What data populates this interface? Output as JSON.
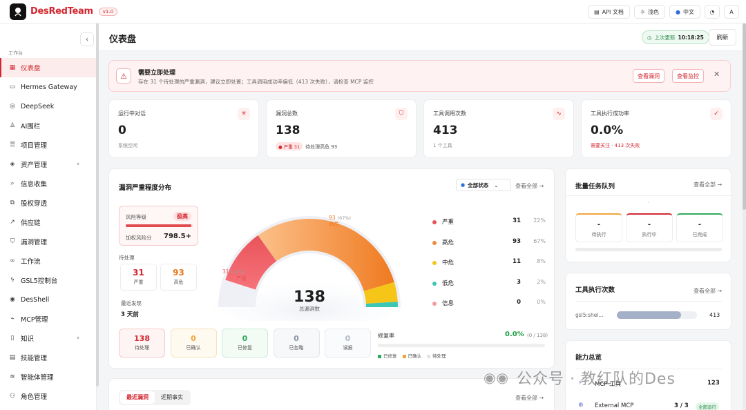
{
  "brand": {
    "name": "DesRedTeam",
    "version": "v1.0"
  },
  "topbar": {
    "api_docs": "API 文档",
    "theme": "浅色",
    "language": "中文"
  },
  "sidebar": {
    "group_label": "工作台",
    "items": [
      {
        "label": "仪表盘",
        "icon": "grid-icon",
        "active": true
      },
      {
        "label": "Hermes Gateway",
        "icon": "chat-icon"
      },
      {
        "label": "DeepSeek",
        "icon": "target-icon"
      },
      {
        "label": "AI围栏",
        "icon": "user-icon"
      },
      {
        "label": "项目管理",
        "icon": "list-icon"
      },
      {
        "label": "资产管理",
        "icon": "layers-icon",
        "expandable": true
      },
      {
        "label": "信息收集",
        "icon": "search-icon"
      },
      {
        "label": "股权穿透",
        "icon": "network-icon"
      },
      {
        "label": "供应链",
        "icon": "trend-icon"
      },
      {
        "label": "漏洞管理",
        "icon": "shield-icon"
      },
      {
        "label": "工作流",
        "icon": "flow-icon"
      },
      {
        "label": "GSL5控制台",
        "icon": "bolt-icon"
      },
      {
        "label": "DesShell",
        "icon": "radio-icon"
      },
      {
        "label": "MCP管理",
        "icon": "plug-icon"
      },
      {
        "label": "知识",
        "icon": "book-icon",
        "expandable": true
      },
      {
        "label": "技能管理",
        "icon": "doc-icon"
      },
      {
        "label": "智能体管理",
        "icon": "stack-icon"
      },
      {
        "label": "角色管理",
        "icon": "users-icon"
      }
    ]
  },
  "header": {
    "title": "仪表盘",
    "last_update_label": "上次更新",
    "last_update_time": "10:18:25",
    "refresh": "刷新"
  },
  "alert": {
    "title": "需要立即处理",
    "text": "存在 31 个待处理的严重漏洞，建议立即处置；工具调用成功率偏低（413 次失败），请检查 MCP 监控",
    "btn_vulns": "查看漏洞",
    "btn_monitor": "查看监控"
  },
  "stats": [
    {
      "label": "运行中对话",
      "value": "0",
      "sub": "系统空闲",
      "icon": "spinner-icon"
    },
    {
      "label": "漏洞总数",
      "value": "138",
      "pill": "● 严重 31",
      "sub": "待处理高危 93",
      "icon": "shield-icon"
    },
    {
      "label": "工具调用次数",
      "value": "413",
      "sub": "1 个工具",
      "icon": "pulse-icon"
    },
    {
      "label": "工具执行成功率",
      "value": "0.0%",
      "sub": "需要关注 · 413 次失败",
      "icon": "check-icon"
    }
  ],
  "severity": {
    "title": "漏洞严重程度分布",
    "filter": "全部状态",
    "view_all": "查看全部 →",
    "risk_label": "风险等级",
    "risk_level": "极高",
    "risk_fill": 0.98,
    "score_label": "加权风险分",
    "score": "798.5+",
    "pending_title": "待处理",
    "pending": [
      {
        "value": "31",
        "label": "严重"
      },
      {
        "value": "93",
        "label": "高危"
      }
    ],
    "recent_title": "最近发现",
    "recent_value": "3 天前",
    "total": "138",
    "total_label": "总漏洞数",
    "arc_labels": [
      {
        "count": "31",
        "pct": "(22%)",
        "name": "严重"
      },
      {
        "count": "93",
        "pct": "(67%)",
        "name": "高危"
      }
    ],
    "legend": [
      {
        "name": "严重",
        "count": "31",
        "pct": "22%",
        "color": "#e9545a"
      },
      {
        "name": "高危",
        "count": "93",
        "pct": "67%",
        "color": "#f28a3a"
      },
      {
        "name": "中危",
        "count": "11",
        "pct": "8%",
        "color": "#f5c518"
      },
      {
        "name": "低危",
        "count": "3",
        "pct": "2%",
        "color": "#3cc7b4"
      },
      {
        "name": "信息",
        "count": "0",
        "pct": "0%",
        "color": "#f19aa0"
      }
    ],
    "status_boxes": [
      {
        "value": "138",
        "label": "待处理"
      },
      {
        "value": "0",
        "label": "已确认"
      },
      {
        "value": "0",
        "label": "已修复"
      },
      {
        "value": "0",
        "label": "已忽略"
      },
      {
        "value": "0",
        "label": "误报"
      }
    ],
    "fix_rate_label": "修复率",
    "fix_rate": "0.0%",
    "fix_rate_den": "(0 / 138)",
    "fix_legend": [
      "已修复",
      "已确认",
      "待处理"
    ]
  },
  "chart_data": {
    "type": "pie",
    "title": "漏洞严重程度分布",
    "categories": [
      "严重",
      "高危",
      "中危",
      "低危",
      "信息"
    ],
    "values": [
      31,
      93,
      11,
      3,
      0
    ]
  },
  "batch_queue": {
    "title": "批量任务队列",
    "view_all": "查看全部 →",
    "dot": "·",
    "boxes": [
      {
        "value": "-",
        "label": "待执行",
        "color": "#f0a43a"
      },
      {
        "value": "-",
        "label": "执行中",
        "color": "#d3272f"
      },
      {
        "value": "-",
        "label": "已完成",
        "color": "#2eaa5c"
      }
    ]
  },
  "tool_exec": {
    "title": "工具执行次数",
    "view_all": "查看全部 →",
    "tool_name": "gsl5:shel...",
    "count": "413",
    "fill": 0.8
  },
  "capability": {
    "title": "能力总览",
    "rows": [
      {
        "icon": "bolt-icon",
        "name": "MCP 工具",
        "value": "123"
      },
      {
        "icon": "globe-icon",
        "name": "External MCP",
        "value": "3 / 3",
        "badge": "全部运行"
      }
    ]
  },
  "recent": {
    "tabs": [
      "最近漏洞",
      "近期事实"
    ],
    "view_all": "查看全部 →"
  },
  "watermark": "公众号 · 教红队的Des"
}
